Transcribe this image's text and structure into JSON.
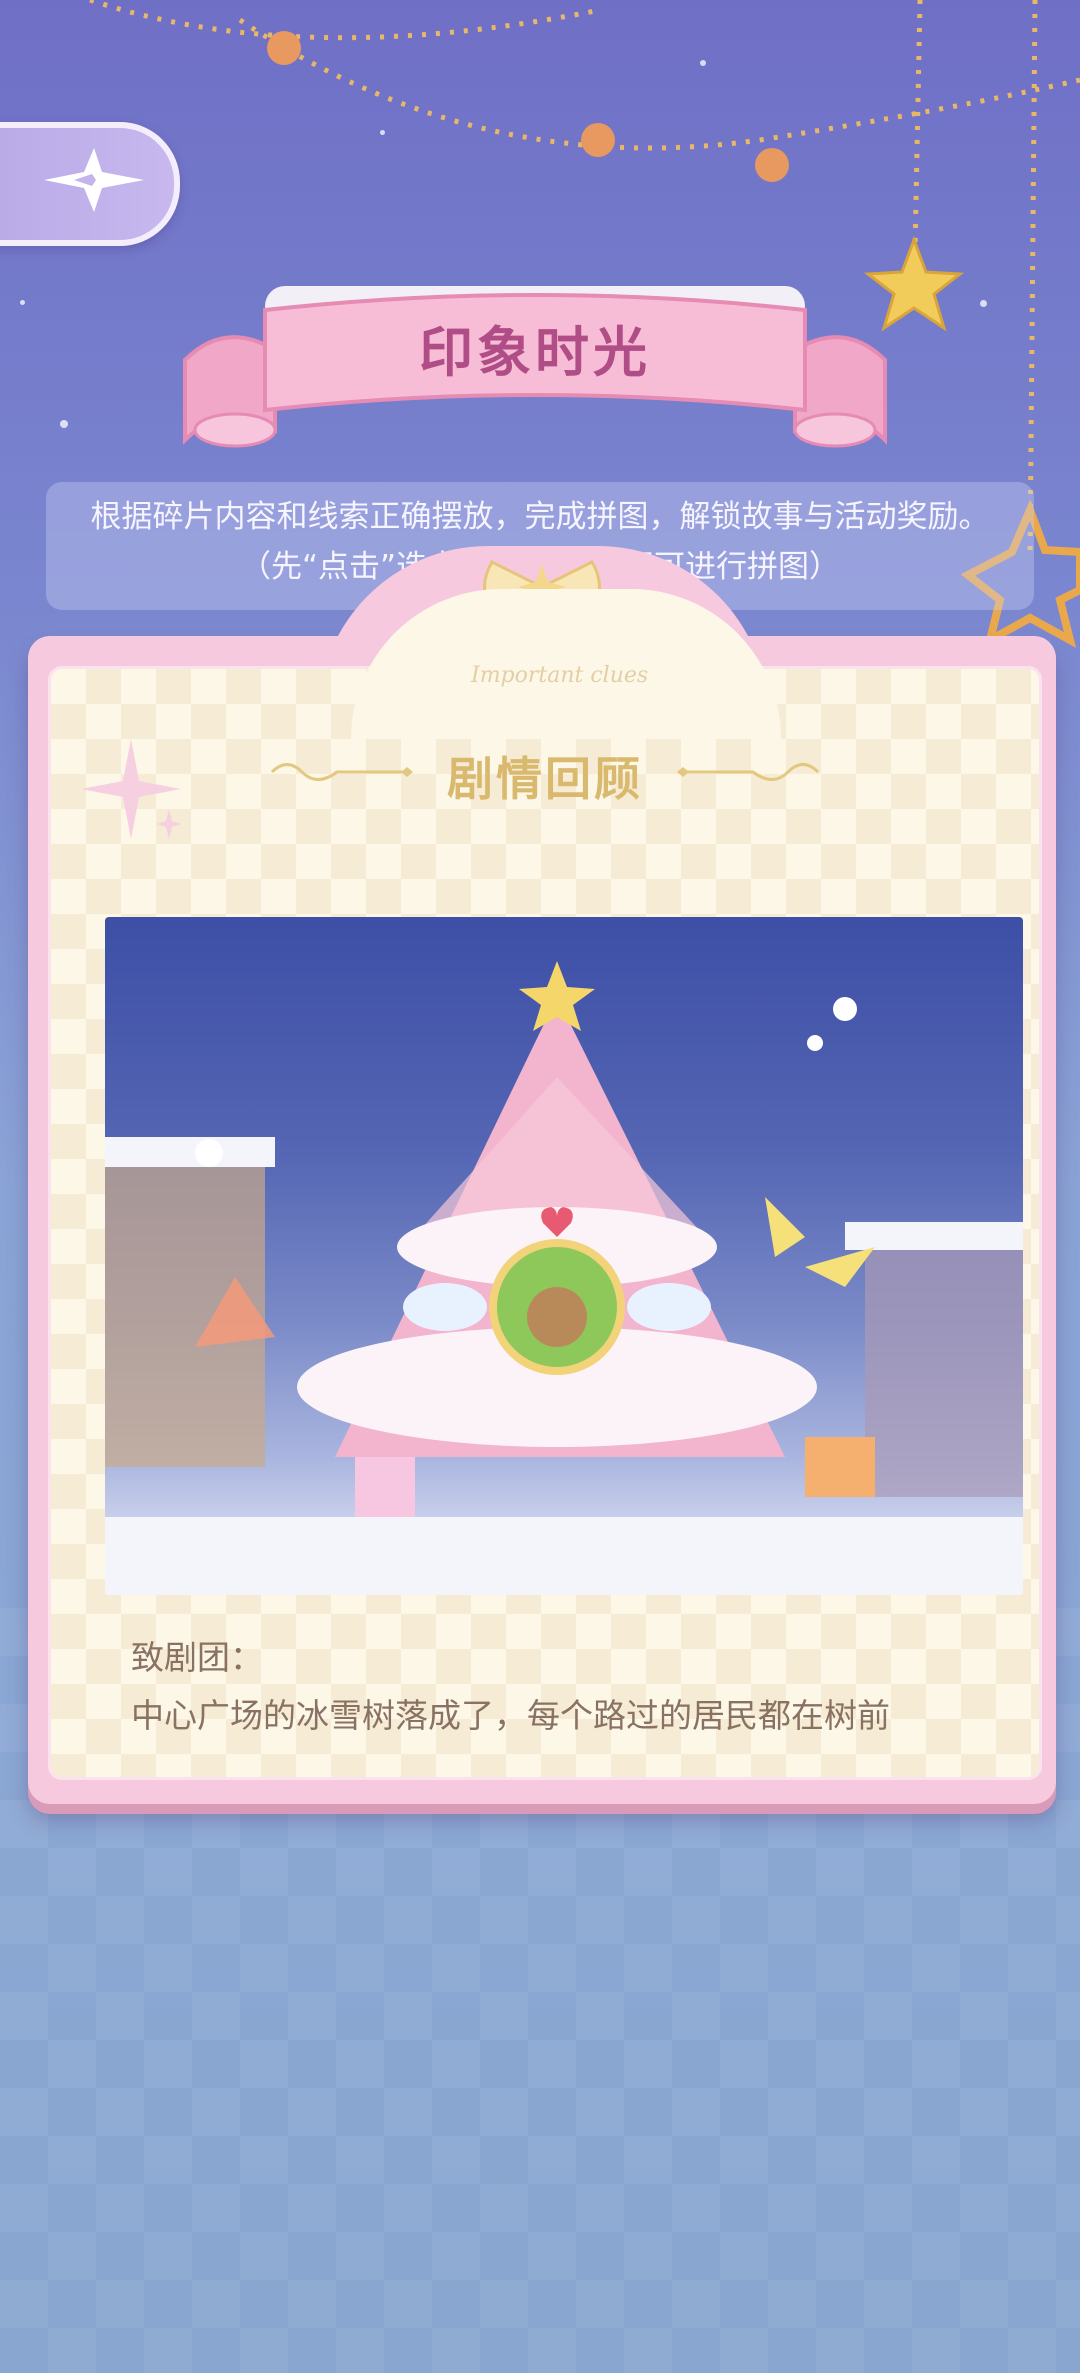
{
  "header": {
    "back_icon": "compass-star-icon",
    "title": "印象时光"
  },
  "instructions": {
    "line1": "根据碎片内容和线索正确摆放，完成拼图，解锁故事与活动奖励。",
    "line2": "（先“点击”选中上方拼                    碎片即可进行拼图）"
  },
  "card": {
    "decor_text": "Important clues",
    "section_title": "剧情回顾",
    "scene_image": "christmas-tree-scene",
    "letter_greeting": "致剧团：",
    "letter_body": "中心广场的冰雪树落成了，每个路过的居民都在树前"
  },
  "colors": {
    "title": "#b04d86",
    "section_title": "#d9b96e",
    "card_frame": "#f7c9de",
    "paper": "#fdf7e8",
    "letter_text": "#8a7263"
  }
}
